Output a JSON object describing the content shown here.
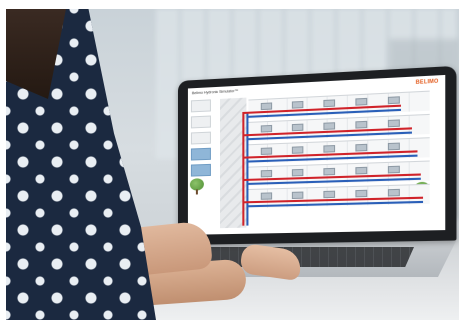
{
  "screen": {
    "app_title": "Belimo Hydronic Simulator™",
    "logo_text": "BELIMO"
  },
  "colors": {
    "supply_pipe": "#d0232a",
    "return_pipe": "#2a5fb8",
    "logo": "#e25a1c",
    "shirt": "#1b2940"
  }
}
